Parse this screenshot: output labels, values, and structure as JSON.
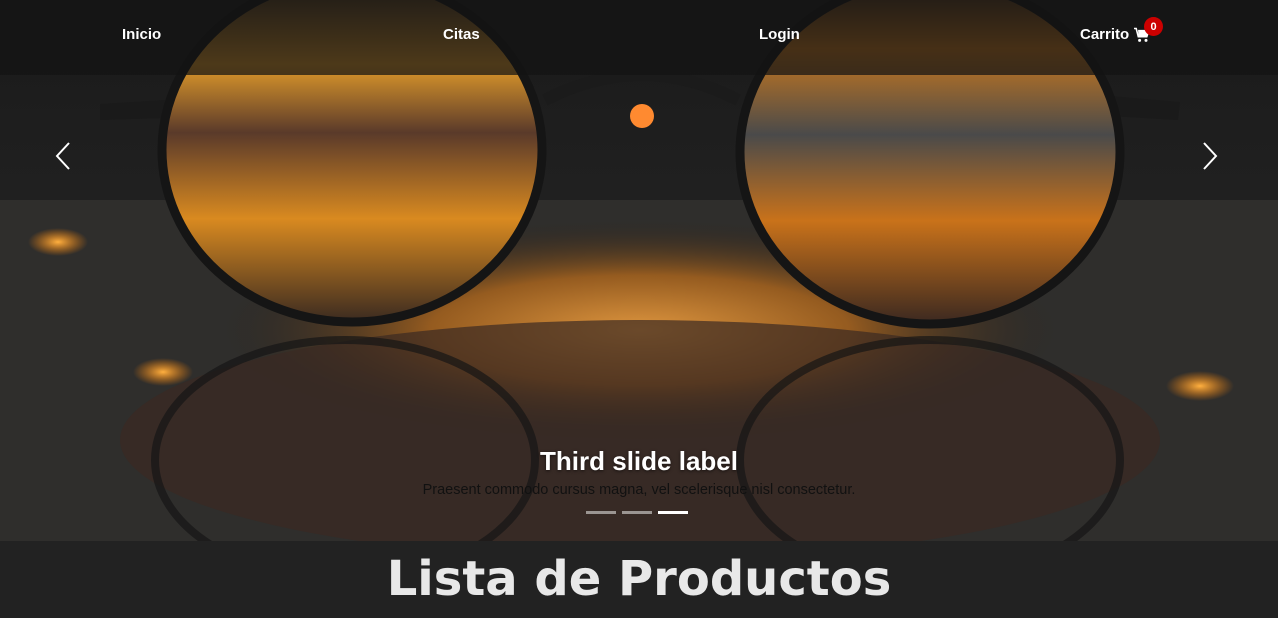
{
  "navbar": {
    "links": [
      {
        "label": "Inicio"
      },
      {
        "label": "Citas"
      },
      {
        "label": "Login"
      }
    ],
    "cart": {
      "label": "Carrito",
      "count": "0",
      "icon": "cart-icon"
    }
  },
  "carousel": {
    "caption_title": "Third slide label",
    "caption_text": "Praesent commodo cursus magna, vel scelerisque nisl consectetur.",
    "slides_count": 3,
    "active_slide": 3,
    "prev_icon": "chevron-left-icon",
    "next_icon": "chevron-right-icon",
    "image_description_icon": "glasses-on-wet-street-image"
  },
  "products": {
    "title": "Lista de Productos"
  },
  "colors": {
    "badge": "#cc0000",
    "section_bg": "#222222"
  }
}
